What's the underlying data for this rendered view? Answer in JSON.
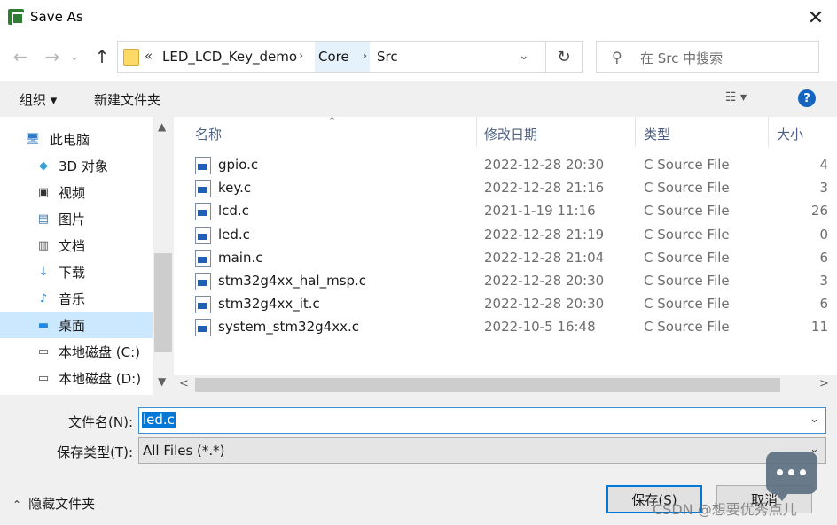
{
  "window": {
    "title": "Save As",
    "close_glyph": "✕"
  },
  "nav": {
    "back_glyph": "←",
    "forward_glyph": "→",
    "recent_glyph": "⌄",
    "up_glyph": "↑"
  },
  "address": {
    "overflow_glyph": "«",
    "crumbs": [
      "LED_LCD_Key_demo",
      "Core",
      "Src"
    ],
    "separator_glyph": "›",
    "dropdown_glyph": "⌄",
    "refresh_glyph": "↻"
  },
  "search": {
    "placeholder": "在 Src 中搜索",
    "icon_glyph": "⚲"
  },
  "toolbar": {
    "organize_label": "组织 ▾",
    "new_folder_label": "新建文件夹",
    "view_glyph": "☷ ▾",
    "help_glyph": "?"
  },
  "sidebar": {
    "items": [
      {
        "label": "此电脑",
        "icon": "computer-icon",
        "glyph": "🖥"
      },
      {
        "label": "3D 对象",
        "icon": "3d-objects-icon",
        "glyph": "◆"
      },
      {
        "label": "视频",
        "icon": "video-icon",
        "glyph": "▣"
      },
      {
        "label": "图片",
        "icon": "pictures-icon",
        "glyph": "▤"
      },
      {
        "label": "文档",
        "icon": "documents-icon",
        "glyph": "▥"
      },
      {
        "label": "下载",
        "icon": "download-icon",
        "glyph": "↓"
      },
      {
        "label": "音乐",
        "icon": "music-icon",
        "glyph": "♪"
      },
      {
        "label": "桌面",
        "icon": "desktop-icon",
        "glyph": "▬"
      },
      {
        "label": "本地磁盘 (C:)",
        "icon": "drive-c-icon",
        "glyph": "▭"
      },
      {
        "label": "本地磁盘 (D:)",
        "icon": "drive-d-icon",
        "glyph": "▭"
      }
    ],
    "selected_index": 7,
    "scroll_up_glyph": "▲",
    "scroll_down_glyph": "▼"
  },
  "files": {
    "columns": [
      "名称",
      "修改日期",
      "类型",
      "大小"
    ],
    "sort_glyph": "⌃",
    "rows": [
      {
        "name": "gpio.c",
        "date": "2022-12-28 20:30",
        "type": "C Source File",
        "size": "4"
      },
      {
        "name": "key.c",
        "date": "2022-12-28 21:16",
        "type": "C Source File",
        "size": "3"
      },
      {
        "name": "lcd.c",
        "date": "2021-1-19 11:16",
        "type": "C Source File",
        "size": "26"
      },
      {
        "name": "led.c",
        "date": "2022-12-28 21:19",
        "type": "C Source File",
        "size": "0"
      },
      {
        "name": "main.c",
        "date": "2022-12-28 21:04",
        "type": "C Source File",
        "size": "6"
      },
      {
        "name": "stm32g4xx_hal_msp.c",
        "date": "2022-12-28 20:30",
        "type": "C Source File",
        "size": "3"
      },
      {
        "name": "stm32g4xx_it.c",
        "date": "2022-12-28 20:30",
        "type": "C Source File",
        "size": "6"
      },
      {
        "name": "system_stm32g4xx.c",
        "date": "2022-10-5 16:48",
        "type": "C Source File",
        "size": "11"
      }
    ],
    "hscroll_left_glyph": "<",
    "hscroll_right_glyph": ">"
  },
  "form": {
    "filename_label": "文件名(N):",
    "filename_value": "led.c",
    "filetype_label": "保存类型(T):",
    "filetype_value": "All Files (*.*)",
    "chevron_glyph": "⌄"
  },
  "footer": {
    "hide_folders_label": "隐藏文件夹",
    "hide_folders_glyph": "⌃",
    "save_label": "保存(S)",
    "cancel_label": "取消"
  },
  "watermark": {
    "text": "CSDN @想要优秀点儿"
  },
  "colors": {
    "accent": "#0078d7",
    "selection": "#cce8ff",
    "header_text": "#4d6082",
    "help": "#1565c0"
  }
}
